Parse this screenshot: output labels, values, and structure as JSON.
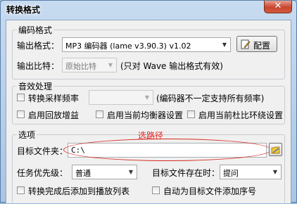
{
  "window": {
    "title": "转换格式",
    "close_glyph": "✕"
  },
  "encoding": {
    "group_title": "编码格式",
    "format_label": "输出格式：",
    "format_value": "MP3 编码器 (lame v3.90.3) v1.02",
    "config_button": "配置",
    "bitrate_label": "输出比特：",
    "bitrate_value": "原始比特",
    "bitrate_note": "(只对 Wave 输出格式有效)"
  },
  "effects": {
    "group_title": "音效处理",
    "resample_label": "转换采样频率",
    "resample_value": "",
    "resample_note": "(编码器不一定支持所有频率)",
    "replay_gain": "启用回放增益",
    "equalizer": "启用当前均衡器设置",
    "dsp": "启用当前杜比环绕设置"
  },
  "options": {
    "group_title": "选项",
    "annotation": "选路径",
    "target_folder_label": "目标文件夹：",
    "target_folder_value": "C:\\",
    "priority_label": "任务优先级：",
    "priority_value": "普通",
    "exists_label": "目标文件存在时：",
    "exists_value": "提问",
    "add_to_playlist": "转换完成后添加到播放列表",
    "auto_number": "自动为目标文件添加序号"
  },
  "colors": {
    "annotation": "#e8201a"
  }
}
